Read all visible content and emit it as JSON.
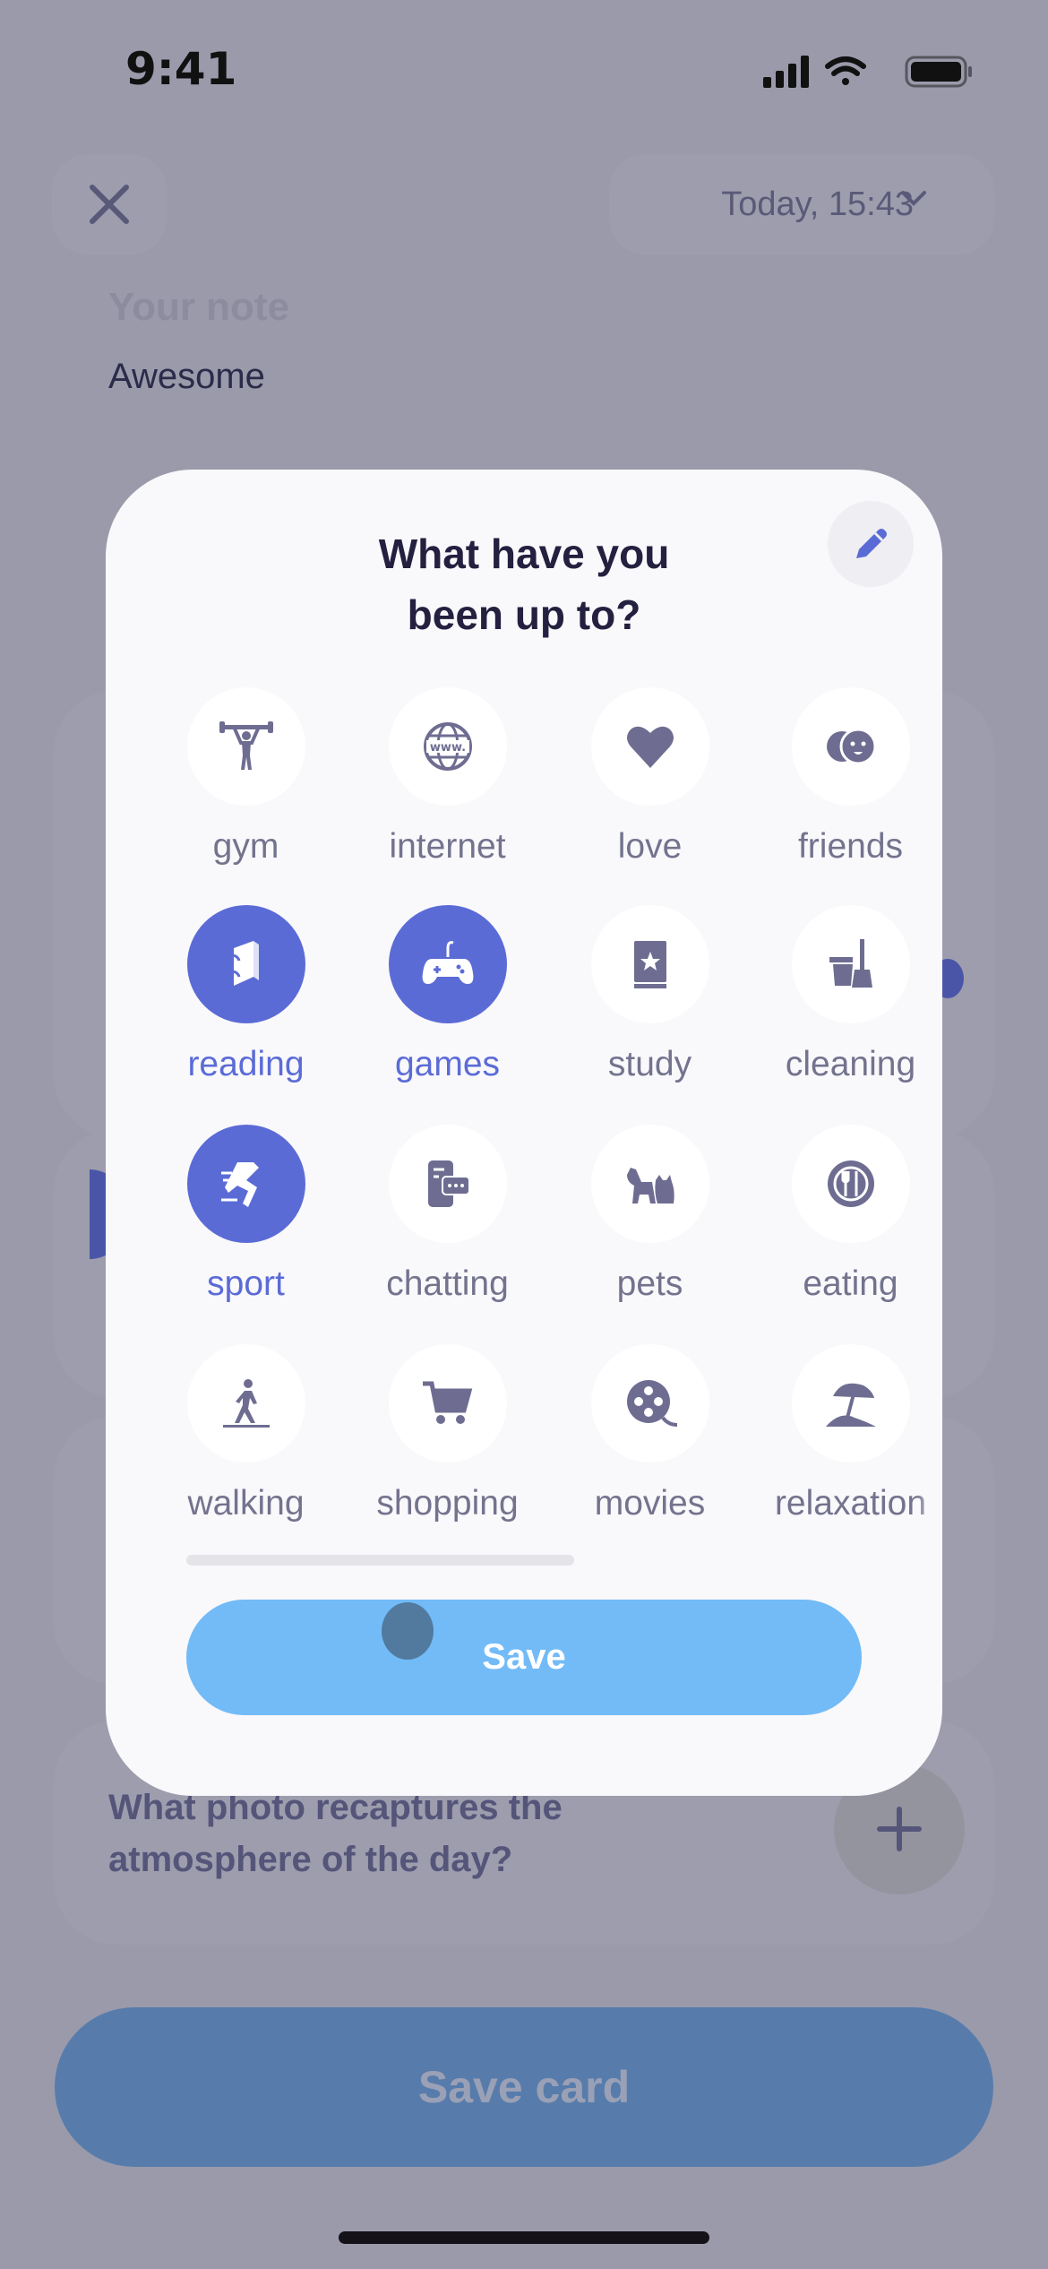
{
  "status_bar": {
    "time": "9:41"
  },
  "header": {
    "date_label": "Today, 15:43"
  },
  "note": {
    "label": "Your note",
    "value": "Awesome"
  },
  "photo": {
    "question": "What photo recaptures the atmosphere of the day?"
  },
  "footer": {
    "save_card_label": "Save card"
  },
  "modal": {
    "title_line1": "What have you",
    "title_line2": "been up to?",
    "save_label": "Save",
    "scroll_progress": 0.5,
    "items": [
      {
        "label": "gym",
        "icon": "weightlifter-icon",
        "selected": false
      },
      {
        "label": "internet",
        "icon": "globe-www-icon",
        "selected": false
      },
      {
        "label": "love",
        "icon": "heart-icon",
        "selected": false
      },
      {
        "label": "friends",
        "icon": "faces-icon",
        "selected": false
      },
      {
        "label": "reading",
        "icon": "book-icon",
        "selected": true
      },
      {
        "label": "games",
        "icon": "gamepad-icon",
        "selected": true
      },
      {
        "label": "study",
        "icon": "star-book-icon",
        "selected": false
      },
      {
        "label": "cleaning",
        "icon": "bucket-broom-icon",
        "selected": false
      },
      {
        "label": "sport",
        "icon": "running-icon",
        "selected": true
      },
      {
        "label": "chatting",
        "icon": "phone-chat-icon",
        "selected": false
      },
      {
        "label": "pets",
        "icon": "dog-cat-icon",
        "selected": false
      },
      {
        "label": "eating",
        "icon": "plate-cutlery-icon",
        "selected": false
      },
      {
        "label": "walking",
        "icon": "walking-person-icon",
        "selected": false
      },
      {
        "label": "shopping",
        "icon": "cart-icon",
        "selected": false
      },
      {
        "label": "movies",
        "icon": "film-reel-icon",
        "selected": false
      },
      {
        "label": "relaxation",
        "icon": "beach-umbrella-icon",
        "selected": false
      }
    ]
  },
  "colors": {
    "accent": "#5b6bd6",
    "icon": "#6e6d91",
    "save": "#72bbf7",
    "save_card": "#577cab",
    "overlay": "#9a9aab"
  }
}
